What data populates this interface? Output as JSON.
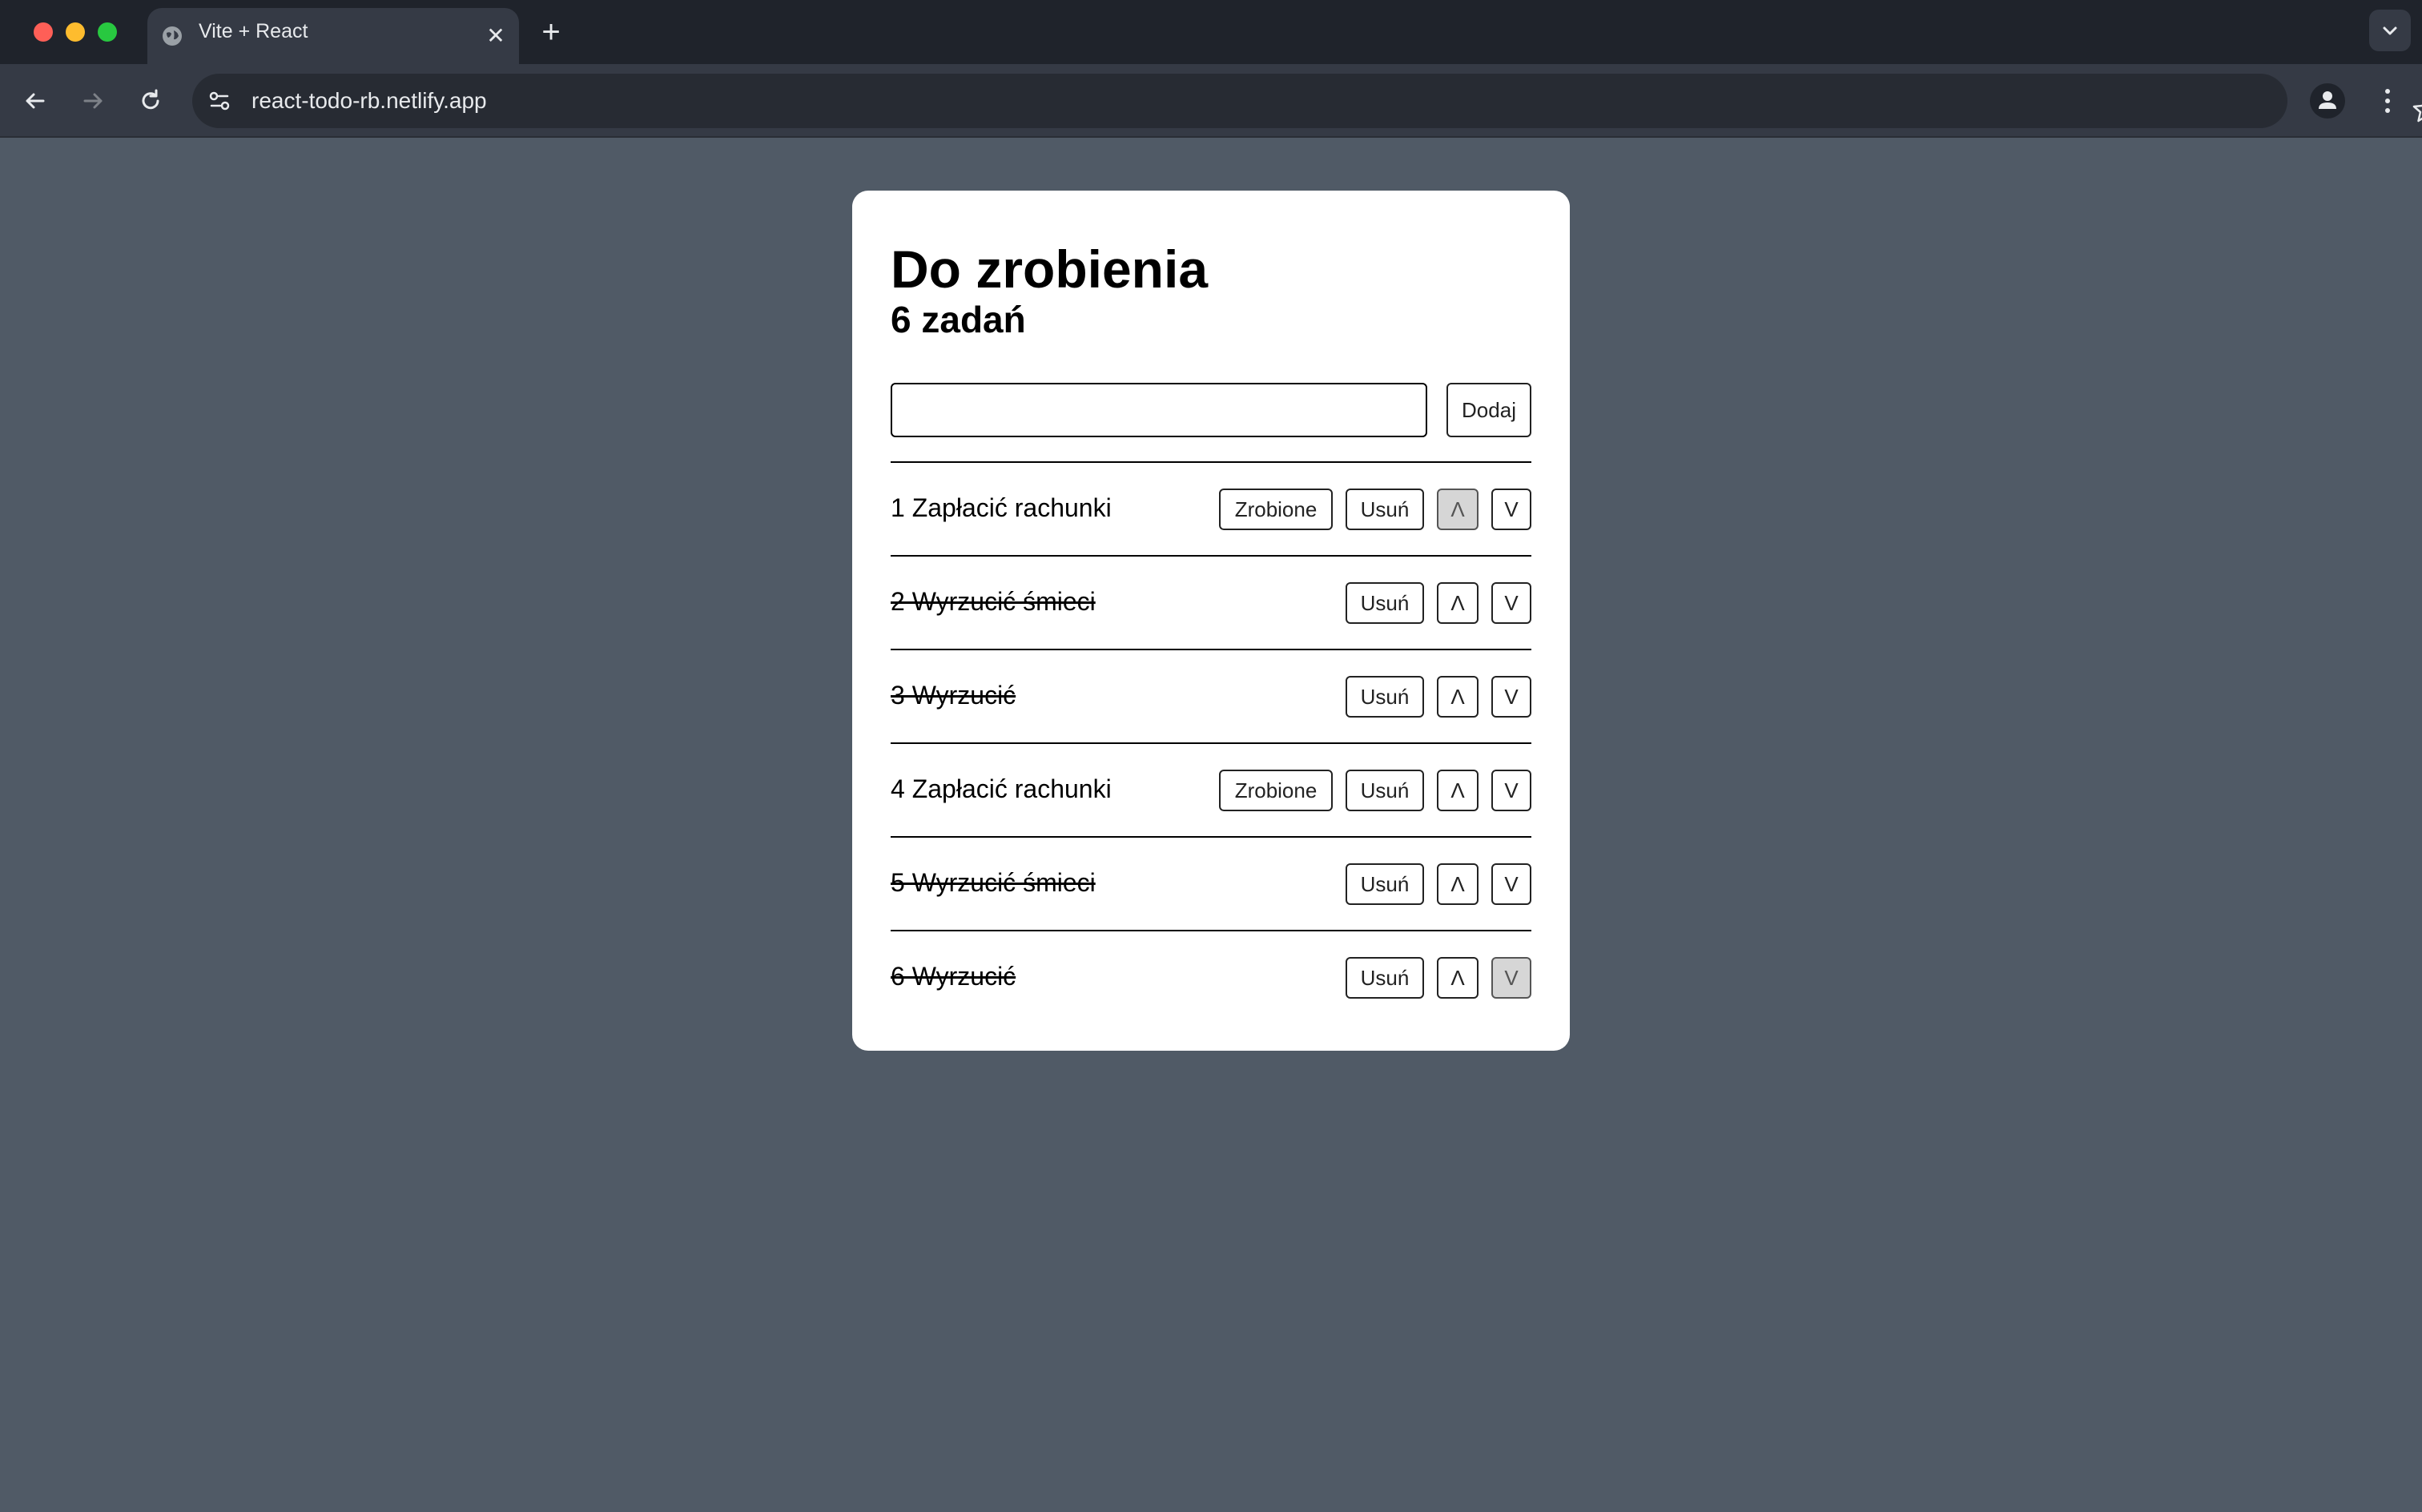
{
  "browser": {
    "tab_title": "Vite + React",
    "url": "react-todo-rb.netlify.app"
  },
  "app": {
    "title": "Do zrobienia",
    "count_label": "6 zadań",
    "new_task_value": "",
    "add_label": "Dodaj",
    "done_label": "Zrobione",
    "delete_label": "Usuń",
    "up_label": "Λ",
    "down_label": "V",
    "tasks": [
      {
        "text": "1 Zapłacić rachunki",
        "done": false,
        "up_disabled": true,
        "down_disabled": false
      },
      {
        "text": "2 Wyrzucić śmieci",
        "done": true,
        "up_disabled": false,
        "down_disabled": false
      },
      {
        "text": "3 Wyrzucić",
        "done": true,
        "up_disabled": false,
        "down_disabled": false
      },
      {
        "text": "4 Zapłacić rachunki",
        "done": false,
        "up_disabled": false,
        "down_disabled": false
      },
      {
        "text": "5 Wyrzucić śmieci",
        "done": true,
        "up_disabled": false,
        "down_disabled": false
      },
      {
        "text": "6 Wyrzucić",
        "done": true,
        "up_disabled": false,
        "down_disabled": true
      }
    ]
  },
  "colors": {
    "page_background": "#505a66",
    "card_background": "#ffffff",
    "disabled_button": "#d6d6d6"
  }
}
